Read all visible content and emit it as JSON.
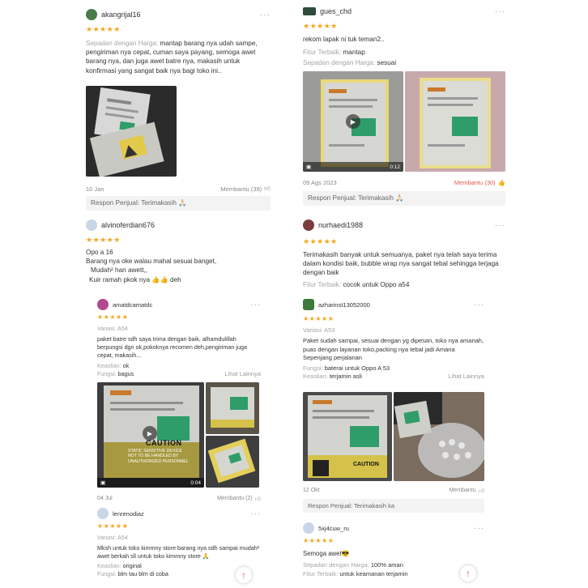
{
  "colors": {
    "star": "#f7a51c",
    "accent": "#e55a4e",
    "battery_green": "#2f9d6a"
  },
  "icons": {
    "star": "star-icon",
    "more": "more-dots-icon",
    "like": "thumb-up-icon",
    "video": "video-camera-icon",
    "play": "play-icon",
    "scroll_top": "arrow-up-icon"
  },
  "stars": "★★★★★",
  "more": "···",
  "reviews": [
    {
      "username": "akangrijal16",
      "rows": [
        {
          "label": "Sepadan dengan Harga:",
          "value": "mantap barang nya udah sampe, pengiriman nya cepat, cuman saya payang, semoga awet barang nya, dan juga awet batre nya, makasih untuk konfirmasi yang sangat baik nya bagi toko ini.."
        }
      ],
      "date": "10 Jan",
      "helpful": "Membantu (39)",
      "seller_response": "Respon Penjual: Terimakasih 🙏🏻"
    },
    {
      "username": "gues_chd",
      "text": "rekom lapak ni tuk teman2..",
      "rows": [
        {
          "label": "Fitur Terbaik:",
          "value": "mantap"
        },
        {
          "label": "Sepadan dengan Harga:",
          "value": "sesuai"
        }
      ],
      "video_time": "0:12",
      "date": "09 Ags 2023",
      "helpful": "Membantu (30)",
      "seller_response": "Respon Penjual: Terimakasih 🙏🏻"
    },
    {
      "username": "alvinoferdian676",
      "text_lines": [
        "Opo a 16",
        "Barang nya oke walau mahal sesuai banget,",
        "Mudah² han awett,,",
        "Kuir ramah pkok nya 👍👍 deh"
      ]
    },
    {
      "username": "nurhaedi1988",
      "text": "Terimakasih banyak untuk semuanya, paket nya telah saya terima dalam kondisi baik, bubble wrap nya sangat tebal sehingga terjaga dengan baik",
      "rows": [
        {
          "label": "Fitur Terbaik:",
          "value": "cocok untuk Oppo a54"
        }
      ]
    },
    {
      "username": "amatdcamatdc",
      "variant": "Variasi: A54",
      "text": "paket batre sdh saya trima dengan baik, alhamdulillah berpungsi dgn ok,pokoknya recomen deh,pengiriman juga cepat, makasih...",
      "rows": [
        {
          "label": "Keaslian:",
          "value": "ok"
        },
        {
          "label": "Fungsi:",
          "value": "bagus"
        }
      ],
      "see_more": "Lihat Lainnya",
      "video_time": "0:04",
      "date": "04 Jul",
      "helpful": "Membantu (2)",
      "caution": [
        "CAUTION",
        "STATIC SENSITIVE DEVICE",
        "NOT TO BE HANDLED BY",
        "UNAUTHORIZED PERSONNEL"
      ]
    },
    {
      "username": "azharinst13052000",
      "variant": "Variasi: A53",
      "text": "Paket sudah sampai, sesuai dengan yg dipesan, toko nya amanah, puas dengan layanan toko,packing nya tebal jadi Amana Sepenjang perjalanan",
      "rows": [
        {
          "label": "Fungsi:",
          "value": "baterai untuk Oppo A 53"
        },
        {
          "label": "Keaslian:",
          "value": "terjamin asli"
        }
      ],
      "see_more": "Lihat Lainnya",
      "date": "12 Okt",
      "helpful": "Membantu",
      "seller_response": "Respon Penjual: Terimakasih ka",
      "caution": [
        "CAUTION"
      ]
    },
    {
      "username": "lenrenodiaz",
      "variant": "Variasi: A54",
      "text": "Mksh untuk toko kimmny store barang nya sdh sampai mudah² awet berkah sll untuk toko kimmny store 🙏",
      "rows": [
        {
          "label": "Keaslian:",
          "value": "original"
        },
        {
          "label": "Fungsi:",
          "value": "blm tau blm di coba"
        }
      ]
    },
    {
      "username": "5xj4cuw_ru",
      "text": "Semoga awet😎",
      "rows": [
        {
          "label": "Sepadan dengan Harga:",
          "value": "100% aman"
        },
        {
          "label": "Fitur Terbaik:",
          "value": "untuk keamanan terjamin"
        }
      ]
    }
  ]
}
